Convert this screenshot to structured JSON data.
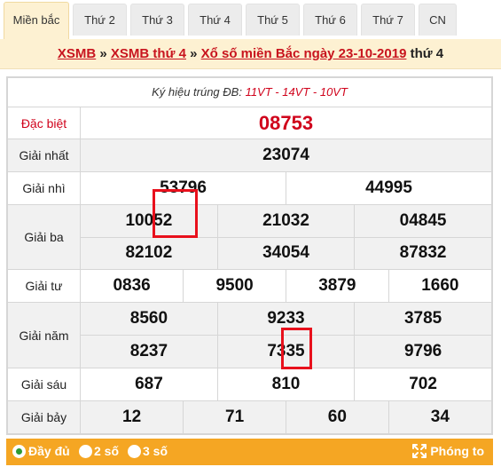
{
  "tabs": [
    "Miền bắc",
    "Thứ 2",
    "Thứ 3",
    "Thứ 4",
    "Thứ 5",
    "Thứ 6",
    "Thứ 7",
    "CN"
  ],
  "breadcrumb": {
    "link1": "XSMB",
    "sep1": " » ",
    "link2": "XSMB thứ 4",
    "sep2": " » ",
    "link3": "Xổ số miền Bắc ngày 23-10-2019",
    "suffix": " thứ 4"
  },
  "symbol": {
    "label": "Ký hiệu trúng ĐB: ",
    "codes": "11VT - 14VT - 10VT"
  },
  "prizes": {
    "special": {
      "label": "Đặc biệt",
      "numbers": [
        "08753"
      ]
    },
    "first": {
      "label": "Giải nhất",
      "numbers": [
        "23074"
      ]
    },
    "second": {
      "label": "Giải nhì",
      "numbers": [
        "53796",
        "44995"
      ]
    },
    "third": {
      "label": "Giải ba",
      "numbers": [
        "10052",
        "21032",
        "04845",
        "82102",
        "34054",
        "87832"
      ]
    },
    "fourth": {
      "label": "Giải tư",
      "numbers": [
        "0836",
        "9500",
        "3879",
        "1660"
      ]
    },
    "fifth": {
      "label": "Giải năm",
      "numbers": [
        "8560",
        "9233",
        "3785",
        "8237",
        "7335",
        "9796"
      ]
    },
    "sixth": {
      "label": "Giải sáu",
      "numbers": [
        "687",
        "810",
        "702"
      ]
    },
    "seventh": {
      "label": "Giải bảy",
      "numbers": [
        "12",
        "71",
        "60",
        "34"
      ]
    }
  },
  "bottom": {
    "options": [
      "Đầy đủ",
      "2 số",
      "3 số"
    ],
    "selected": "Đầy đủ",
    "zoom_label": "Phóng to"
  },
  "colors": {
    "accent_red": "#d0021b",
    "bar_orange": "#f5a623",
    "tab_active_bg": "#fdf1d2"
  }
}
